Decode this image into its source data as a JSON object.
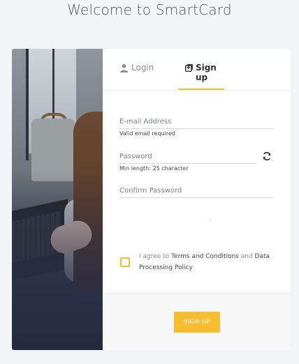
{
  "page": {
    "title": "Welcome to SmartCard"
  },
  "tabs": [
    {
      "label": "Login",
      "icon": "user-icon"
    },
    {
      "label": "Sign up",
      "icon": "plus-square-icon"
    }
  ],
  "form": {
    "email_label": "E-mail Address",
    "email_hint": "Valid email required",
    "password_label": "Password",
    "password_hint": "Min length: 25 character",
    "confirm_label": "Confirm Password"
  },
  "agreement": {
    "prefix": "I agree to ",
    "terms": "Terms and Conditions",
    "and": " and ",
    "policy": "Data Processing Policy"
  },
  "button": {
    "signup_label": "SIGN UP"
  },
  "colors": {
    "accent": "#f6bd2e",
    "background": "#f3f4f6"
  }
}
